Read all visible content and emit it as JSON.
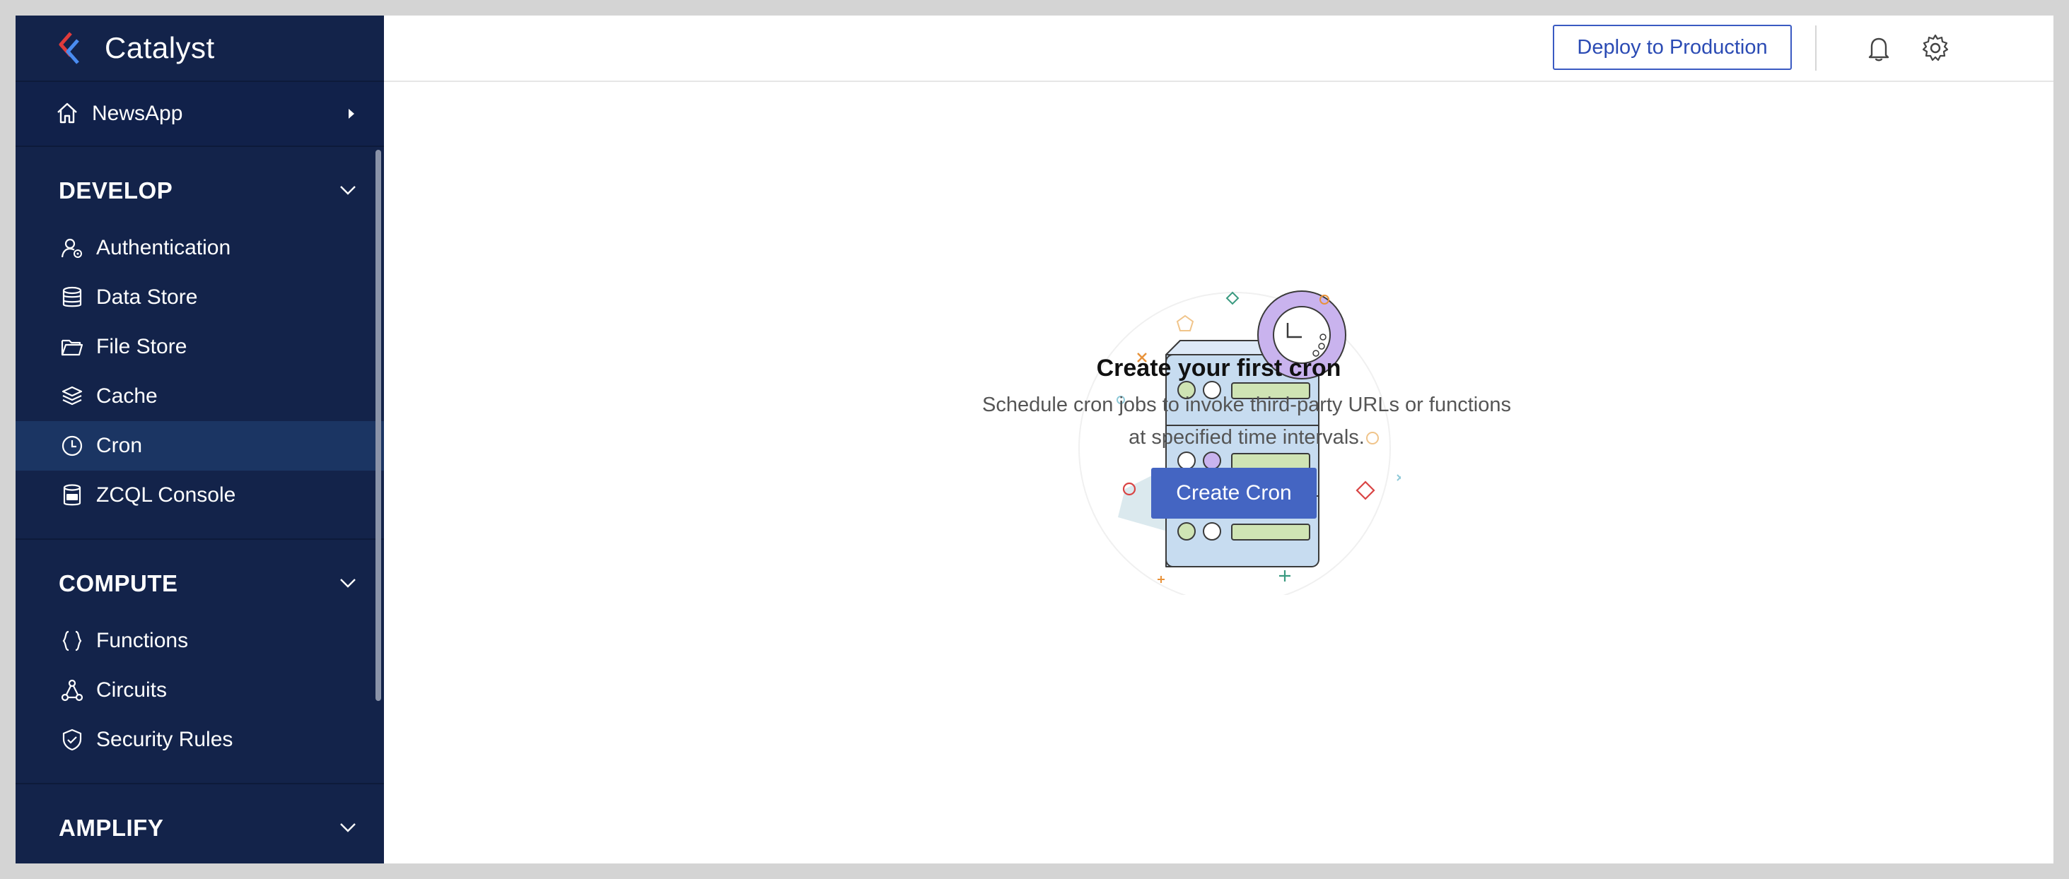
{
  "brand": {
    "name": "Catalyst",
    "logo_icon": "catalyst-logo"
  },
  "project": {
    "name": "NewsApp",
    "icon": "home-icon"
  },
  "sections": {
    "develop": {
      "label": "DEVELOP",
      "items": [
        {
          "label": "Authentication",
          "icon": "user-lock-icon"
        },
        {
          "label": "Data Store",
          "icon": "database-icon"
        },
        {
          "label": "File Store",
          "icon": "folder-icon"
        },
        {
          "label": "Cache",
          "icon": "layers-icon"
        },
        {
          "label": "Cron",
          "icon": "clock-icon",
          "active": true
        },
        {
          "label": "ZCQL Console",
          "icon": "sql-icon"
        }
      ]
    },
    "compute": {
      "label": "COMPUTE",
      "items": [
        {
          "label": "Functions",
          "icon": "braces-icon"
        },
        {
          "label": "Circuits",
          "icon": "circuit-icon"
        },
        {
          "label": "Security Rules",
          "icon": "shield-icon"
        }
      ]
    },
    "amplify": {
      "label": "AMPLIFY"
    }
  },
  "topbar": {
    "deploy_label": "Deploy to Production",
    "icons": [
      "bell-icon",
      "gear-icon",
      "avatar"
    ]
  },
  "empty_state": {
    "title": "Create your first cron",
    "description_line1": "Schedule cron jobs to invoke third-party URLs or functions",
    "description_line2": "at specified time intervals.",
    "button_label": "Create Cron"
  },
  "colors": {
    "sidebar_bg": "#13234a",
    "active_item_bg": "#1b3563",
    "primary_button": "#4465c2",
    "deploy_border": "#3a5ac2"
  }
}
